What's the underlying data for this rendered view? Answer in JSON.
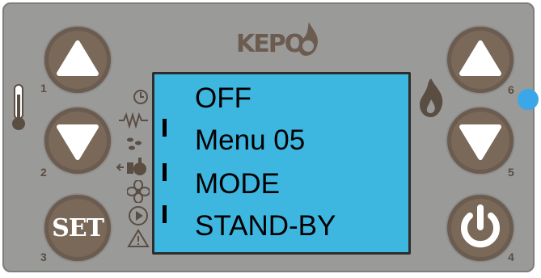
{
  "brand": {
    "logo_text": "KEPO"
  },
  "display": {
    "lines": [
      "OFF",
      "Menu 05",
      "MODE",
      "STAND-BY"
    ],
    "background_color": "#3db6e0"
  },
  "buttons": {
    "b1": {
      "number": "1",
      "icon": "up-triangle-icon"
    },
    "b2": {
      "number": "2",
      "icon": "down-triangle-icon"
    },
    "b3": {
      "number": "3",
      "label": "SET"
    },
    "b4": {
      "number": "4",
      "icon": "power-icon"
    },
    "b5": {
      "number": "5",
      "icon": "down-triangle-icon"
    },
    "b6": {
      "number": "6",
      "icon": "up-triangle-icon"
    }
  },
  "side_icons": {
    "left": [
      "thermometer-icon"
    ],
    "lcd_left": [
      "clock-icon",
      "heater-wave-icon",
      "pellet-icon",
      "ignition-icon",
      "fan-icon",
      "play-icon",
      "warning-icon"
    ],
    "right": [
      "flame-icon"
    ]
  },
  "indicator": {
    "led_color": "#3aa8e8"
  },
  "colors": {
    "panel": "#9a9a99",
    "button": "#7a6959",
    "accent_text": "#5a4d42"
  }
}
